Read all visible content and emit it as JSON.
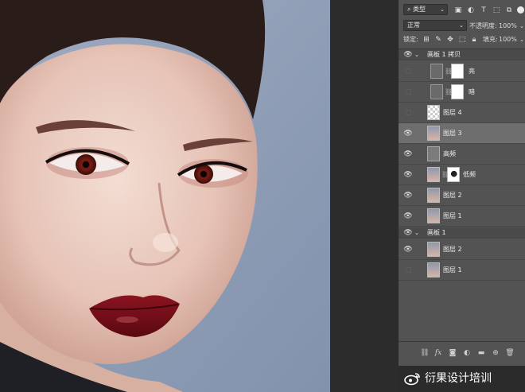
{
  "toolbar": {
    "filter_kind": "类型",
    "blend_mode": "正常",
    "opacity_label": "不透明度:",
    "opacity_value": "100%",
    "lock_label": "锁定:",
    "fill_label": "填充:",
    "fill_value": "100%"
  },
  "layers": [
    {
      "name": "画板 1 拷贝",
      "kind": "group",
      "visible": true
    },
    {
      "name": "亮",
      "kind": "curves",
      "visible": false
    },
    {
      "name": "暗",
      "kind": "curves",
      "visible": false
    },
    {
      "name": "图层 4",
      "kind": "transparent",
      "visible": false
    },
    {
      "name": "图层 3",
      "kind": "photo",
      "visible": true,
      "selected": true
    },
    {
      "name": "高频",
      "kind": "gray",
      "visible": true
    },
    {
      "name": "低频",
      "kind": "photo-mask",
      "visible": true
    },
    {
      "name": "图层 2",
      "kind": "photo",
      "visible": true
    },
    {
      "name": "图层 1",
      "kind": "photo",
      "visible": true
    },
    {
      "name": "画板 1",
      "kind": "group",
      "visible": true
    },
    {
      "name": "图层 2",
      "kind": "photo",
      "visible": true
    },
    {
      "name": "图层 1",
      "kind": "photo",
      "visible": false
    }
  ],
  "icons": {
    "search": "search-icon",
    "eye": "eye-icon",
    "link": "link-icon",
    "fx": "fx"
  },
  "watermark": "衍果设计培训",
  "colors": {
    "panel_bg": "#535353",
    "selected_row": "#6e6e6e",
    "backdrop": "#8f9db5",
    "lipstick": "#7a0f18"
  }
}
